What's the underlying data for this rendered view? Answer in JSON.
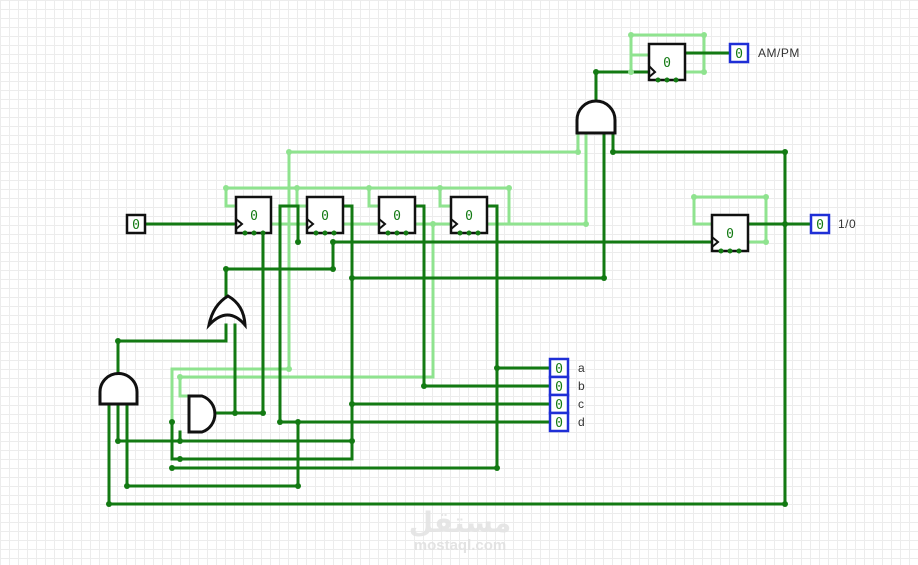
{
  "circuit": {
    "clock_input_value": "0",
    "flip_flop_values": [
      "0",
      "0",
      "0",
      "0"
    ],
    "ampm_ff_value": "0",
    "onoff_ff_value": "0",
    "outputs": {
      "ampm": {
        "value": "0",
        "label": "AM/PM"
      },
      "onoff": {
        "value": "0",
        "label": "1/0"
      },
      "a": {
        "value": "0",
        "label": "a"
      },
      "b": {
        "value": "0",
        "label": "b"
      },
      "c": {
        "value": "0",
        "label": "c"
      },
      "d": {
        "value": "0",
        "label": "d"
      }
    }
  },
  "watermark": {
    "logo": "مستقل",
    "text": "mostaql.com"
  },
  "colors": {
    "wire_active": "#137a13",
    "wire_idle": "#8fe38f",
    "output_border": "#1f2fd6",
    "component_stroke": "#111111"
  }
}
